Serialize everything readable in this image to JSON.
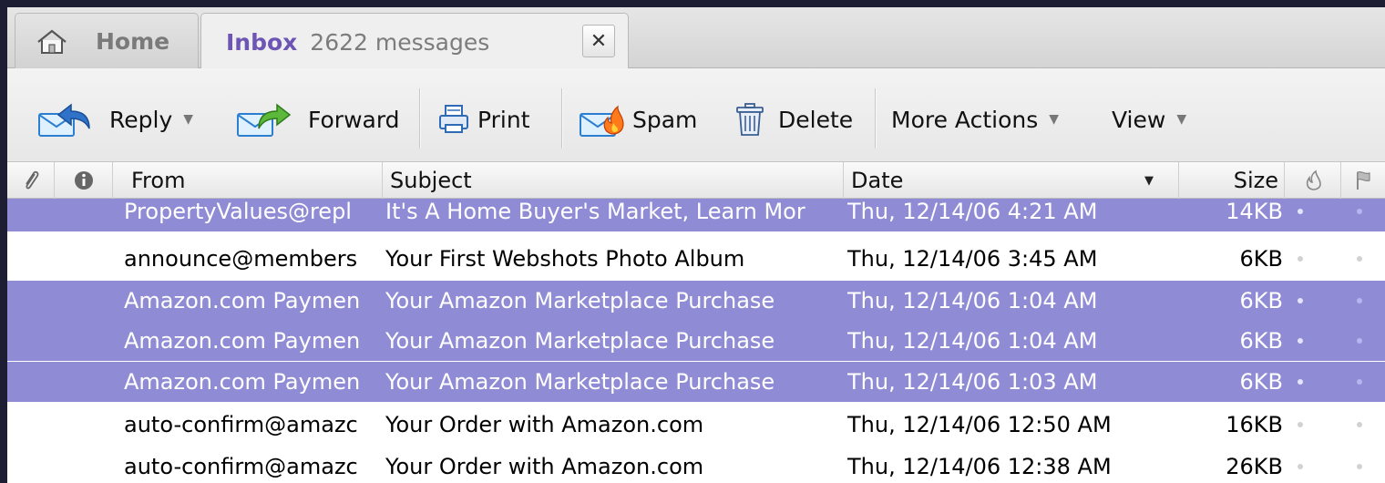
{
  "tabs": {
    "home": {
      "label": "Home",
      "icon": "home-icon"
    },
    "inbox": {
      "label": "Inbox",
      "count": "2622 messages",
      "close": "✕"
    }
  },
  "toolbar": {
    "reply": "Reply",
    "forward": "Forward",
    "print": "Print",
    "spam": "Spam",
    "delete": "Delete",
    "more_actions": "More Actions",
    "view": "View"
  },
  "columns": {
    "from": "From",
    "subject": "Subject",
    "date": "Date",
    "size": "Size"
  },
  "colors": {
    "selected_row": "#8f8bd4",
    "inbox_tab_text": "#6d55b5",
    "window_background": "#1d1e33"
  },
  "messages": [
    {
      "from": "PropertyValues@repl",
      "subject": "It's A Home Buyer's Market, Learn Mor",
      "date": "Thu, 12/14/06 4:21 AM",
      "size": "14KB",
      "selected": true
    },
    {
      "from": "announce@members",
      "subject": "Your First Webshots Photo Album",
      "date": "Thu, 12/14/06 3:45 AM",
      "size": "6KB",
      "selected": false
    },
    {
      "from": "Amazon.com Paymen",
      "subject": "Your Amazon Marketplace Purchase",
      "date": "Thu, 12/14/06 1:04 AM",
      "size": "6KB",
      "selected": true
    },
    {
      "from": "Amazon.com Paymen",
      "subject": "Your Amazon Marketplace Purchase",
      "date": "Thu, 12/14/06 1:04 AM",
      "size": "6KB",
      "selected": true
    },
    {
      "from": "Amazon.com Paymen",
      "subject": "Your Amazon Marketplace Purchase",
      "date": "Thu, 12/14/06 1:03 AM",
      "size": "6KB",
      "selected": true
    },
    {
      "from": "auto-confirm@amazc",
      "subject": "Your Order with Amazon.com",
      "date": "Thu, 12/14/06 12:50 AM",
      "size": "16KB",
      "selected": false
    },
    {
      "from": "auto-confirm@amazc",
      "subject": "Your Order with Amazon.com",
      "date": "Thu, 12/14/06 12:38 AM",
      "size": "26KB",
      "selected": false
    }
  ]
}
